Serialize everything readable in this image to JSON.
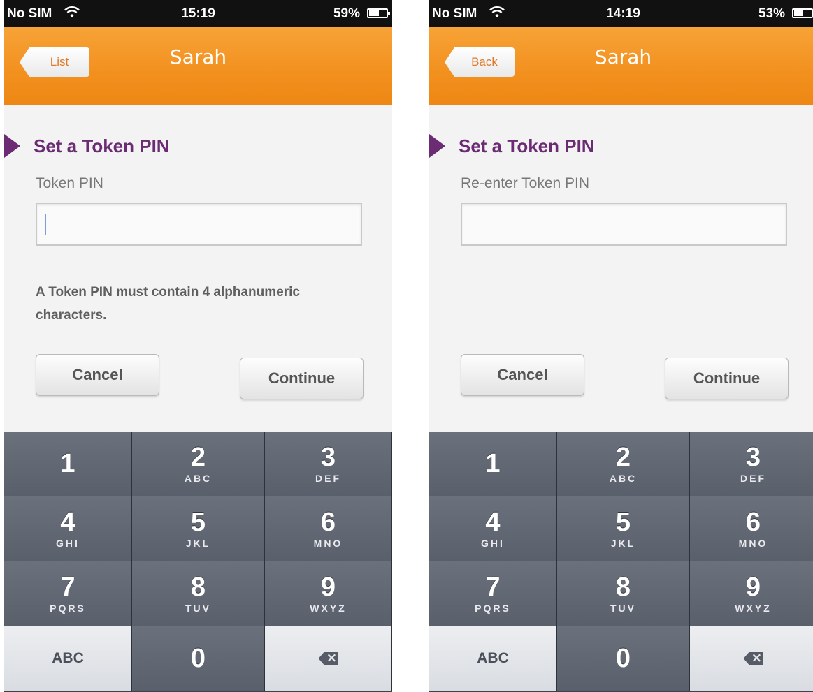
{
  "screens": [
    {
      "status": {
        "carrier": "No SIM",
        "time": "15:19",
        "battery": "59%",
        "battery_level": 0.59
      },
      "nav": {
        "back_label": "List",
        "title": "Sarah"
      },
      "section_title": "Set a Token PIN",
      "field_label": "Token PIN",
      "input_value": "",
      "hint": "A Token PIN must contain 4 alphanumeric characters.",
      "cancel_label": "Cancel",
      "continue_label": "Continue"
    },
    {
      "status": {
        "carrier": "No SIM",
        "time": "14:19",
        "battery": "53%",
        "battery_level": 0.53
      },
      "nav": {
        "back_label": "Back",
        "title": "Sarah"
      },
      "section_title": "Set a Token PIN",
      "field_label": "Re-enter Token PIN",
      "input_value": "",
      "hint": "",
      "cancel_label": "Cancel",
      "continue_label": "Continue"
    }
  ],
  "keypad": {
    "keys": [
      {
        "digit": "1",
        "letters": ""
      },
      {
        "digit": "2",
        "letters": "ABC"
      },
      {
        "digit": "3",
        "letters": "DEF"
      },
      {
        "digit": "4",
        "letters": "GHI"
      },
      {
        "digit": "5",
        "letters": "JKL"
      },
      {
        "digit": "6",
        "letters": "MNO"
      },
      {
        "digit": "7",
        "letters": "PQRS"
      },
      {
        "digit": "8",
        "letters": "TUV"
      },
      {
        "digit": "9",
        "letters": "WXYZ"
      }
    ],
    "abc_label": "ABC",
    "zero": "0"
  },
  "colors": {
    "accent_orange": "#f2901e",
    "title_purple": "#6b2c74",
    "keypad": "#5a606b"
  },
  "icons": [
    "wifi-icon",
    "battery-icon",
    "back-arrow",
    "delete-icon"
  ]
}
